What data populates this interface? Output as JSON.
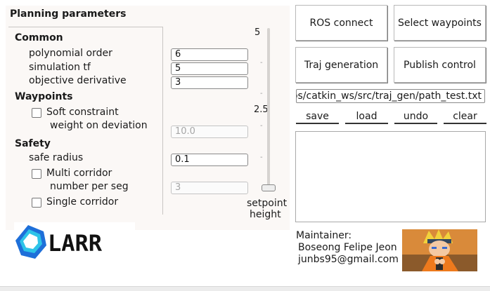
{
  "panel": {
    "title": "Planning parameters",
    "common": {
      "header": "Common",
      "polynomial_order": {
        "label": "polynomial order",
        "value": "6"
      },
      "simulation_tf": {
        "label": "simulation tf",
        "value": "5"
      },
      "objective_derivative": {
        "label": "objective derivative",
        "value": "3"
      }
    },
    "waypoints": {
      "header": "Waypoints",
      "soft_constraint": {
        "label": "Soft constraint",
        "checked": false
      },
      "weight_on_deviation": {
        "label": "weight on deviation",
        "placeholder": "10.0"
      }
    },
    "safety": {
      "header": "Safety",
      "safe_radius": {
        "label": "safe radius",
        "value": "0.1"
      },
      "multi_corridor": {
        "label": "Multi corridor",
        "checked": false
      },
      "number_per_seg": {
        "label": "number per seg",
        "placeholder": "3"
      },
      "single_corridor": {
        "label": "Single corridor",
        "checked": false
      }
    }
  },
  "slider": {
    "max_label": "5",
    "mid_label": "2.5",
    "caption_line1": "setpoint",
    "caption_line2": "height",
    "value_fraction": 0.0
  },
  "logo": {
    "text": "LARR",
    "colors": [
      "#1e6fd9",
      "#2ec4e8"
    ]
  },
  "buttons": {
    "ros_connect": "ROS connect",
    "select_waypoints": "Select waypoints",
    "traj_generation": "Traj generation",
    "publish_control": "Publish control"
  },
  "path": {
    "value": "/home/jbs/catkin_ws/src/traj_gen/path_test.txt",
    "visible": "s/catkin_ws/src/traj_gen/path_test.txt"
  },
  "file_buttons": {
    "save": "save",
    "load": "load",
    "undo": "undo",
    "clear": "clear"
  },
  "maintainer": {
    "label": "Maintainer:",
    "name": "Boseong Felipe Jeon",
    "email": "junbs95@gmail.com",
    "avatar_icon": "anime-character-avatar"
  }
}
